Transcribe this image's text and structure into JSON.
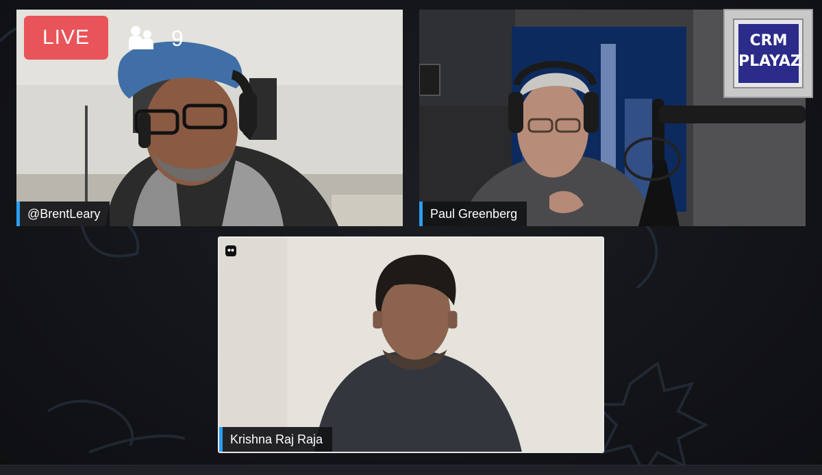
{
  "broadcast": {
    "live_label": "LIVE",
    "viewer_count": "9",
    "viewer_icon": "people-icon"
  },
  "logo": {
    "line1": "CRM",
    "line2": "PLAYAZ"
  },
  "participants": [
    {
      "name": "@BrentLeary"
    },
    {
      "name": "Paul Greenberg"
    },
    {
      "name": "Krishna Raj Raja"
    }
  ],
  "colors": {
    "live_badge": "#e85459",
    "name_accent": "#2b9ef3",
    "background": "#141519"
  }
}
